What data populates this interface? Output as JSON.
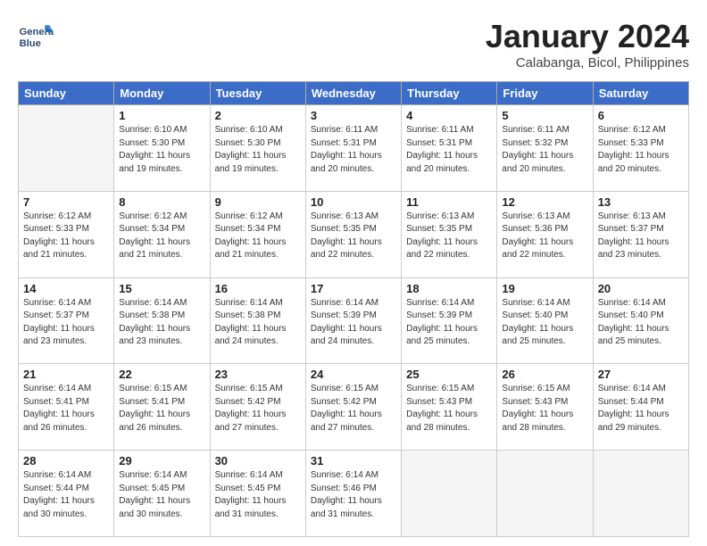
{
  "header": {
    "logo_line1": "General",
    "logo_line2": "Blue",
    "title": "January 2024",
    "subtitle": "Calabanga, Bicol, Philippines"
  },
  "columns": [
    "Sunday",
    "Monday",
    "Tuesday",
    "Wednesday",
    "Thursday",
    "Friday",
    "Saturday"
  ],
  "weeks": [
    [
      {
        "day": "",
        "info": ""
      },
      {
        "day": "1",
        "info": "Sunrise: 6:10 AM\nSunset: 5:30 PM\nDaylight: 11 hours\nand 19 minutes."
      },
      {
        "day": "2",
        "info": "Sunrise: 6:10 AM\nSunset: 5:30 PM\nDaylight: 11 hours\nand 19 minutes."
      },
      {
        "day": "3",
        "info": "Sunrise: 6:11 AM\nSunset: 5:31 PM\nDaylight: 11 hours\nand 20 minutes."
      },
      {
        "day": "4",
        "info": "Sunrise: 6:11 AM\nSunset: 5:31 PM\nDaylight: 11 hours\nand 20 minutes."
      },
      {
        "day": "5",
        "info": "Sunrise: 6:11 AM\nSunset: 5:32 PM\nDaylight: 11 hours\nand 20 minutes."
      },
      {
        "day": "6",
        "info": "Sunrise: 6:12 AM\nSunset: 5:33 PM\nDaylight: 11 hours\nand 20 minutes."
      }
    ],
    [
      {
        "day": "7",
        "info": "Sunrise: 6:12 AM\nSunset: 5:33 PM\nDaylight: 11 hours\nand 21 minutes."
      },
      {
        "day": "8",
        "info": "Sunrise: 6:12 AM\nSunset: 5:34 PM\nDaylight: 11 hours\nand 21 minutes."
      },
      {
        "day": "9",
        "info": "Sunrise: 6:12 AM\nSunset: 5:34 PM\nDaylight: 11 hours\nand 21 minutes."
      },
      {
        "day": "10",
        "info": "Sunrise: 6:13 AM\nSunset: 5:35 PM\nDaylight: 11 hours\nand 22 minutes."
      },
      {
        "day": "11",
        "info": "Sunrise: 6:13 AM\nSunset: 5:35 PM\nDaylight: 11 hours\nand 22 minutes."
      },
      {
        "day": "12",
        "info": "Sunrise: 6:13 AM\nSunset: 5:36 PM\nDaylight: 11 hours\nand 22 minutes."
      },
      {
        "day": "13",
        "info": "Sunrise: 6:13 AM\nSunset: 5:37 PM\nDaylight: 11 hours\nand 23 minutes."
      }
    ],
    [
      {
        "day": "14",
        "info": "Sunrise: 6:14 AM\nSunset: 5:37 PM\nDaylight: 11 hours\nand 23 minutes."
      },
      {
        "day": "15",
        "info": "Sunrise: 6:14 AM\nSunset: 5:38 PM\nDaylight: 11 hours\nand 23 minutes."
      },
      {
        "day": "16",
        "info": "Sunrise: 6:14 AM\nSunset: 5:38 PM\nDaylight: 11 hours\nand 24 minutes."
      },
      {
        "day": "17",
        "info": "Sunrise: 6:14 AM\nSunset: 5:39 PM\nDaylight: 11 hours\nand 24 minutes."
      },
      {
        "day": "18",
        "info": "Sunrise: 6:14 AM\nSunset: 5:39 PM\nDaylight: 11 hours\nand 25 minutes."
      },
      {
        "day": "19",
        "info": "Sunrise: 6:14 AM\nSunset: 5:40 PM\nDaylight: 11 hours\nand 25 minutes."
      },
      {
        "day": "20",
        "info": "Sunrise: 6:14 AM\nSunset: 5:40 PM\nDaylight: 11 hours\nand 25 minutes."
      }
    ],
    [
      {
        "day": "21",
        "info": "Sunrise: 6:14 AM\nSunset: 5:41 PM\nDaylight: 11 hours\nand 26 minutes."
      },
      {
        "day": "22",
        "info": "Sunrise: 6:15 AM\nSunset: 5:41 PM\nDaylight: 11 hours\nand 26 minutes."
      },
      {
        "day": "23",
        "info": "Sunrise: 6:15 AM\nSunset: 5:42 PM\nDaylight: 11 hours\nand 27 minutes."
      },
      {
        "day": "24",
        "info": "Sunrise: 6:15 AM\nSunset: 5:42 PM\nDaylight: 11 hours\nand 27 minutes."
      },
      {
        "day": "25",
        "info": "Sunrise: 6:15 AM\nSunset: 5:43 PM\nDaylight: 11 hours\nand 28 minutes."
      },
      {
        "day": "26",
        "info": "Sunrise: 6:15 AM\nSunset: 5:43 PM\nDaylight: 11 hours\nand 28 minutes."
      },
      {
        "day": "27",
        "info": "Sunrise: 6:14 AM\nSunset: 5:44 PM\nDaylight: 11 hours\nand 29 minutes."
      }
    ],
    [
      {
        "day": "28",
        "info": "Sunrise: 6:14 AM\nSunset: 5:44 PM\nDaylight: 11 hours\nand 30 minutes."
      },
      {
        "day": "29",
        "info": "Sunrise: 6:14 AM\nSunset: 5:45 PM\nDaylight: 11 hours\nand 30 minutes."
      },
      {
        "day": "30",
        "info": "Sunrise: 6:14 AM\nSunset: 5:45 PM\nDaylight: 11 hours\nand 31 minutes."
      },
      {
        "day": "31",
        "info": "Sunrise: 6:14 AM\nSunset: 5:46 PM\nDaylight: 11 hours\nand 31 minutes."
      },
      {
        "day": "",
        "info": ""
      },
      {
        "day": "",
        "info": ""
      },
      {
        "day": "",
        "info": ""
      }
    ]
  ]
}
